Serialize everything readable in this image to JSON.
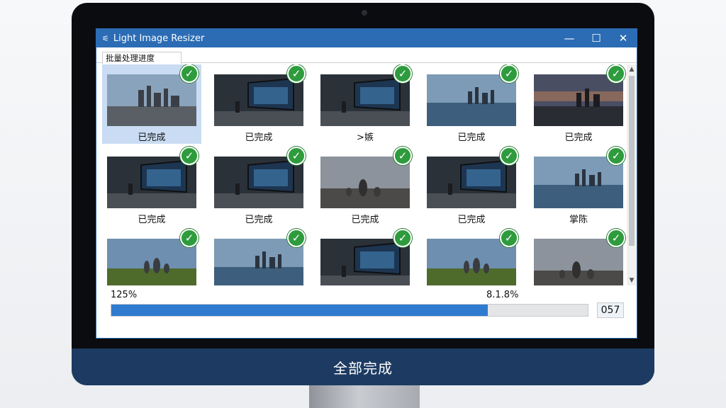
{
  "window": {
    "title": "Light Image Resizer",
    "tab_label": "批量处理进度",
    "controls": {
      "minimize": "—",
      "maximize": "☐",
      "close": "✕"
    }
  },
  "tiles": [
    {
      "label": "已完成",
      "scene": "city"
    },
    {
      "label": "已完成",
      "scene": "screen"
    },
    {
      "label": ">嫉",
      "scene": "screen"
    },
    {
      "label": "已完成",
      "scene": "lake"
    },
    {
      "label": "已完成",
      "scene": "dusk"
    },
    {
      "label": "已完成",
      "scene": "screen"
    },
    {
      "label": "已完成",
      "scene": "screen"
    },
    {
      "label": "已完成",
      "scene": "rocks"
    },
    {
      "label": "已完成",
      "scene": "screen"
    },
    {
      "label": "掌陈",
      "scene": "lake"
    },
    {
      "label": "",
      "scene": "field"
    },
    {
      "label": "",
      "scene": "lake"
    },
    {
      "label": "",
      "scene": "screen"
    },
    {
      "label": "",
      "scene": "field"
    },
    {
      "label": "",
      "scene": "rocks"
    }
  ],
  "progress": {
    "left_text": "125%",
    "right_text": "8.1.8%",
    "fill_fraction": 0.79,
    "count": "057"
  },
  "footer": {
    "status": "全部完成"
  },
  "colors": {
    "accent": "#2b6cb4",
    "check": "#2e9b3d",
    "chin": "#1d3b62"
  }
}
